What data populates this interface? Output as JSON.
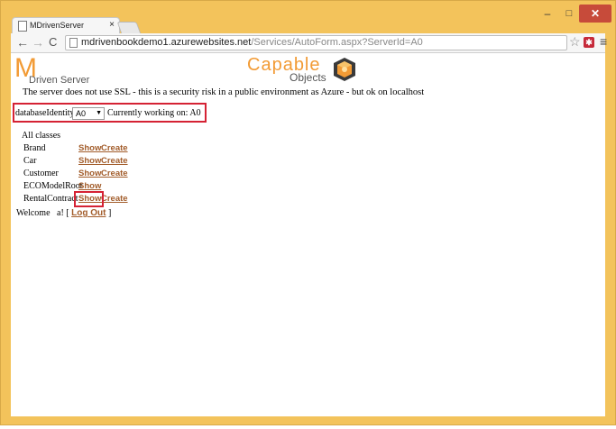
{
  "browser": {
    "tab_title": "MDrivenServer",
    "tab_close": "×",
    "url_host": "mdrivenbookdemo1.azurewebsites.net",
    "url_path": "/Services/AutoForm.aspx?ServerId=A0",
    "window_controls": {
      "minimize": "–",
      "maximize": "□",
      "close": "✕"
    },
    "nav": {
      "back": "←",
      "forward": "→",
      "reload": "C"
    },
    "star": "☆",
    "extension": "✱",
    "menu": "≡"
  },
  "page": {
    "logo_m": "M",
    "logo_text": "Driven Server",
    "capable_line1": "Capable",
    "capable_line2": "Objects",
    "warning": "The server does not use SSL - this is a security risk in a public environment as Azure - but ok on localhost",
    "db_label": "databaseIdentity:",
    "db_selected": "A0",
    "db_arrow": "▼",
    "working_on": "Currently working on: A0",
    "all_classes": "All classes",
    "classes": [
      {
        "name": "Brand",
        "show": "Show",
        "create": "Create"
      },
      {
        "name": "Car",
        "show": "Show",
        "create": "Create"
      },
      {
        "name": "Customer",
        "show": "Show",
        "create": "Create"
      },
      {
        "name": "ECOModelRoot",
        "show": "Show",
        "create": ""
      },
      {
        "name": "RentalContract",
        "show": "Show",
        "create": "Create"
      }
    ],
    "welcome_prefix": "Welcome",
    "welcome_user": "a! [",
    "logout": "Log Out",
    "welcome_suffix": "]"
  },
  "colors": {
    "frame": "#f3c35b",
    "link": "#a25c2a",
    "highlight": "#d52234",
    "logo_orange": "#f29b35"
  }
}
